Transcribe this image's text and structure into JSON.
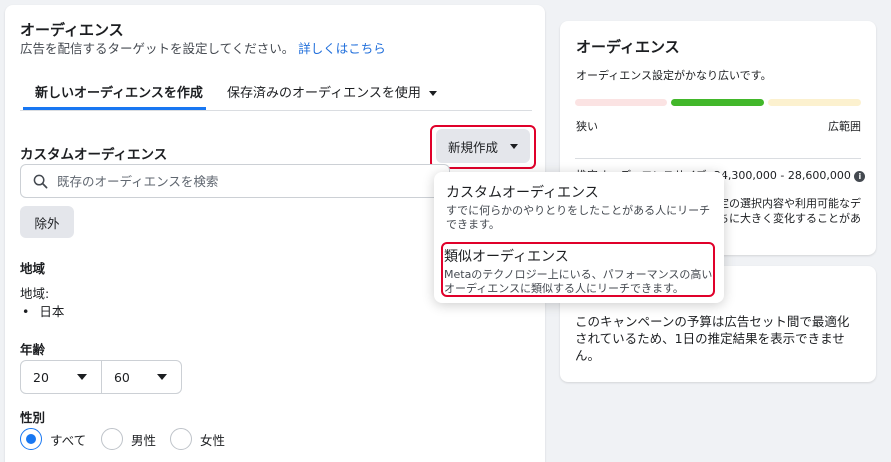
{
  "audience": {
    "title": "オーディエンス",
    "subtitle": "広告を配信するターゲットを設定してください。",
    "learn_more": "詳しくはこちら",
    "tabs": [
      {
        "label": "新しいオーディエンスを作成"
      },
      {
        "label": "保存済みのオーディエンスを使用"
      }
    ],
    "custom_audience_label": "カスタムオーディエンス",
    "new_button": "新規作成",
    "search_placeholder": "既存のオーディエンスを検索",
    "exclude_button": "除外",
    "location": {
      "heading": "地域",
      "label": "地域:",
      "value": "日本"
    },
    "age": {
      "heading": "年齢",
      "min": "20",
      "max": "60"
    },
    "gender": {
      "heading": "性別",
      "options": [
        "すべて",
        "男性",
        "女性"
      ],
      "selected": "すべて"
    }
  },
  "dropdown": {
    "items": [
      {
        "title": "カスタムオーディエンス",
        "desc": [
          "すでに何らかのやりとりをしたことがある人にリーチ",
          "できます。"
        ]
      },
      {
        "title": "類似オーディエンス",
        "desc": [
          "Metaのテクノロジー上にいる、パフォーマンスの高い",
          "オーディエンスに類似する人にリーチできます。"
        ]
      }
    ]
  },
  "summary": {
    "title": "オーディエンス",
    "status": "オーディエンス設定がかなり広いです。",
    "narrow_label": "狭い",
    "broad_label": "広範囲",
    "size_label": "推定オーディエンスサイズ:",
    "size_value": "24,300,000 - 28,600,000",
    "note_lines": [
      "定の選択内容や利用可能なデ",
      "ちに大きく変化することがあ"
    ]
  },
  "budget_note": {
    "text_lines": [
      "このキャンペーンの予算は広告セット間で最適化",
      "されているため、1日の推定結果を表示できませ",
      "ん。"
    ]
  },
  "colors": {
    "accent": "#1877f2",
    "link": "#216fdb",
    "highlight": "#e0002a",
    "meter_narrow": "#fbe3e3",
    "meter_good": "#42b72a",
    "meter_broad": "#fcf1cf"
  },
  "meter_level": "broad"
}
